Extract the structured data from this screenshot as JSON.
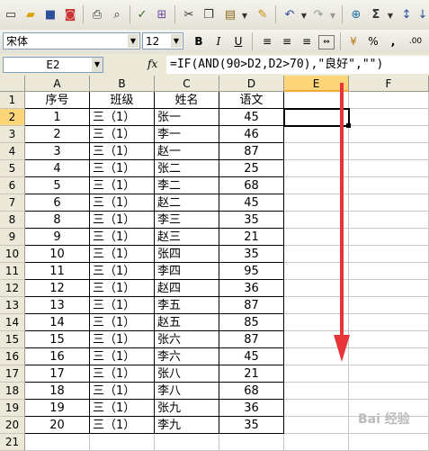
{
  "name_box": "E2",
  "fx_label": "fx",
  "formula": "=IF(AND(90>D2,D2>70),\"良好\",\"\")",
  "font": {
    "name": "宋体",
    "size": "12"
  },
  "format_buttons": {
    "bold": "B",
    "italic": "I",
    "underline": "U",
    "percent": "%",
    "comma": ",",
    "decimals": ".00"
  },
  "columns": [
    "A",
    "B",
    "C",
    "D",
    "E",
    "F"
  ],
  "active_column": "E",
  "active_row": "2",
  "headers": [
    "序号",
    "班级",
    "姓名",
    "语文"
  ],
  "rows": [
    {
      "n": "1",
      "seq": "1",
      "cls": "三（1）",
      "name": "张一",
      "score": "45"
    },
    {
      "n": "2",
      "seq": "2",
      "cls": "三（1）",
      "name": "李一",
      "score": "46"
    },
    {
      "n": "3",
      "seq": "3",
      "cls": "三（1）",
      "name": "赵一",
      "score": "87"
    },
    {
      "n": "4",
      "seq": "4",
      "cls": "三（1）",
      "name": "张二",
      "score": "25"
    },
    {
      "n": "5",
      "seq": "5",
      "cls": "三（1）",
      "name": "李二",
      "score": "68"
    },
    {
      "n": "6",
      "seq": "6",
      "cls": "三（1）",
      "name": "赵二",
      "score": "45"
    },
    {
      "n": "7",
      "seq": "8",
      "cls": "三（1）",
      "name": "李三",
      "score": "35"
    },
    {
      "n": "8",
      "seq": "9",
      "cls": "三（1）",
      "name": "赵三",
      "score": "21"
    },
    {
      "n": "9",
      "seq": "10",
      "cls": "三（1）",
      "name": "张四",
      "score": "35"
    },
    {
      "n": "10",
      "seq": "11",
      "cls": "三（1）",
      "name": "李四",
      "score": "95"
    },
    {
      "n": "11",
      "seq": "12",
      "cls": "三（1）",
      "name": "赵四",
      "score": "36"
    },
    {
      "n": "12",
      "seq": "13",
      "cls": "三（1）",
      "name": "李五",
      "score": "87"
    },
    {
      "n": "13",
      "seq": "14",
      "cls": "三（1）",
      "name": "赵五",
      "score": "85"
    },
    {
      "n": "14",
      "seq": "15",
      "cls": "三（1）",
      "name": "张六",
      "score": "87"
    },
    {
      "n": "15",
      "seq": "16",
      "cls": "三（1）",
      "name": "李六",
      "score": "45"
    },
    {
      "n": "16",
      "seq": "17",
      "cls": "三（1）",
      "name": "张八",
      "score": "21"
    },
    {
      "n": "17",
      "seq": "18",
      "cls": "三（1）",
      "name": "李八",
      "score": "68"
    },
    {
      "n": "18",
      "seq": "19",
      "cls": "三（1）",
      "name": "张九",
      "score": "36"
    },
    {
      "n": "19",
      "seq": "20",
      "cls": "三（1）",
      "name": "李九",
      "score": "35"
    }
  ],
  "row_numbers": [
    "1",
    "2",
    "3",
    "4",
    "5",
    "6",
    "7",
    "8",
    "9",
    "10",
    "11",
    "12",
    "13",
    "14",
    "15",
    "16",
    "17",
    "18",
    "19",
    "20",
    "21"
  ],
  "annotation_color": "#e8353a",
  "watermark": "Bai 经验"
}
